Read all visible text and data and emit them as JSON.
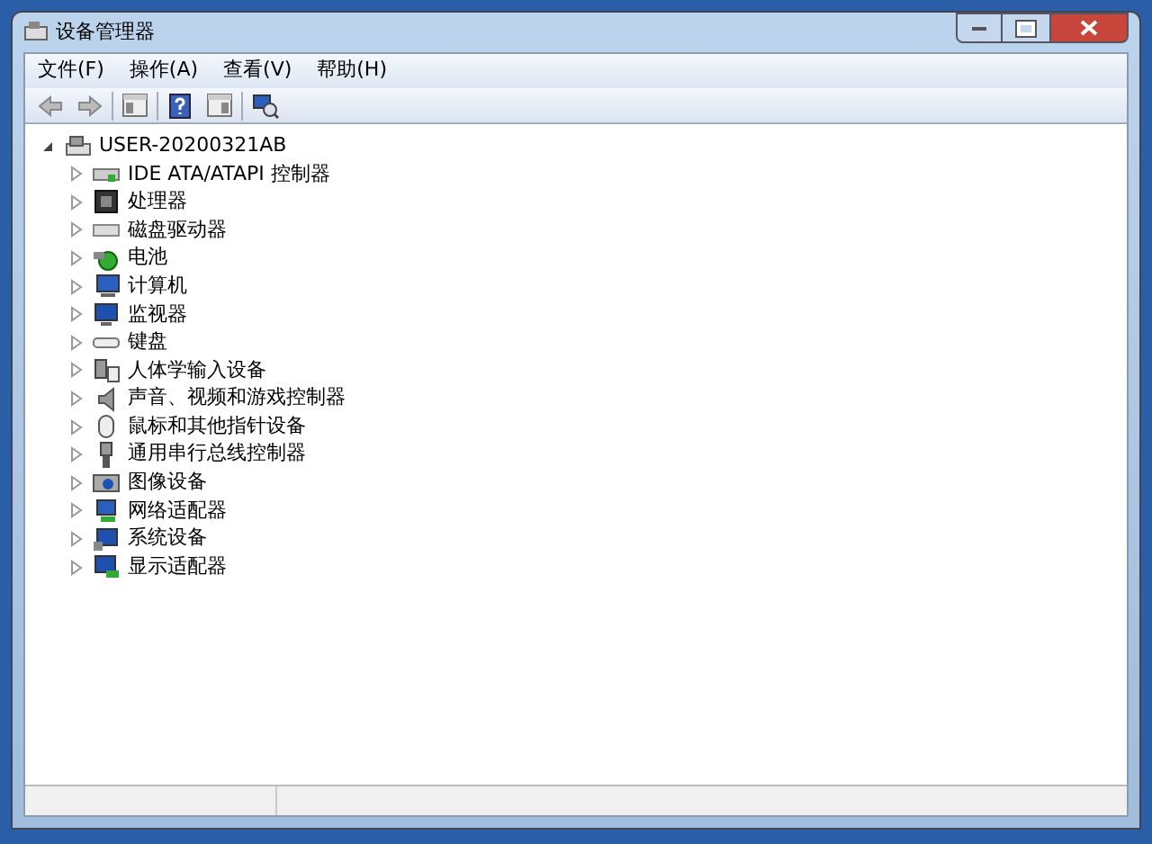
{
  "window": {
    "title": "设备管理器"
  },
  "menu": [
    "文件(F)",
    "操作(A)",
    "查看(V)",
    "帮助(H)"
  ],
  "tree": {
    "label": "USER-20200321AB",
    "expanded": true,
    "children": [
      {
        "label": "IDE ATA/ATAPI 控制器",
        "expanded": false
      },
      {
        "label": "处理器",
        "expanded": false
      },
      {
        "label": "磁盘驱动器",
        "expanded": false
      },
      {
        "label": "电池",
        "expanded": false
      },
      {
        "label": "计算机",
        "expanded": false
      },
      {
        "label": "监视器",
        "expanded": false
      },
      {
        "label": "键盘",
        "expanded": false
      },
      {
        "label": "人体学输入设备",
        "expanded": false
      },
      {
        "label": "声音、视频和游戏控制器",
        "expanded": false
      },
      {
        "label": "鼠标和其他指针设备",
        "expanded": false
      },
      {
        "label": "通用串行总线控制器",
        "expanded": false
      },
      {
        "label": "图像设备",
        "expanded": false
      },
      {
        "label": "网络适配器",
        "expanded": false
      },
      {
        "label": "系统设备",
        "expanded": false
      },
      {
        "label": "显示适配器",
        "expanded": false
      }
    ]
  }
}
